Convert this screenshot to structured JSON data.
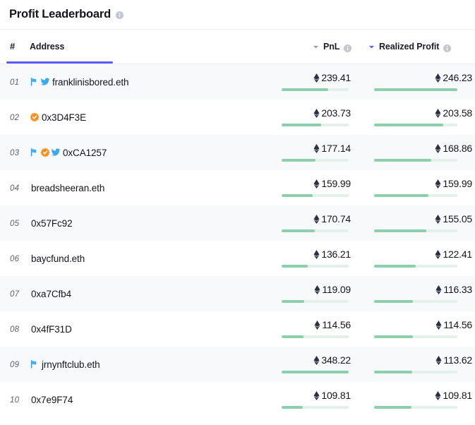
{
  "header": {
    "title": "Profit Leaderboard",
    "title_info_icon": "info-icon"
  },
  "table": {
    "columns": {
      "rank": "#",
      "address": "Address",
      "pnl": "PnL",
      "realized_profit": "Realized Profit"
    },
    "sort": {
      "active_column": "Realized Profit",
      "active_color": "#5b5bf7",
      "inactive_color": "#9aa0ae",
      "direction": "desc"
    },
    "icons": {
      "sort_caret": "chevron-down-icon",
      "info": "info-icon",
      "flag": "flag-icon",
      "opensea": "opensea-verified-icon",
      "twitter": "twitter-icon",
      "currency": "ethereum-icon"
    },
    "colors": {
      "bar_fill": "#8ccfaa",
      "bar_track": "#e4f0ea",
      "row_alt": "#f8f9fb",
      "accent": "#5b5bf7"
    },
    "rows": [
      {
        "rank": "01",
        "address": "franklinisbored.eth",
        "badges": [
          "flag-icon",
          "twitter-icon"
        ],
        "pnl": "239.41",
        "pnl_pct": 69,
        "realized": "246.23",
        "realized_pct": 100
      },
      {
        "rank": "02",
        "address": "0x3D4F3E",
        "badges": [
          "opensea-verified-icon"
        ],
        "pnl": "203.73",
        "pnl_pct": 59,
        "realized": "203.58",
        "realized_pct": 83
      },
      {
        "rank": "03",
        "address": "0xCA1257",
        "badges": [
          "flag-icon",
          "opensea-verified-icon",
          "twitter-icon"
        ],
        "pnl": "177.14",
        "pnl_pct": 51,
        "realized": "168.86",
        "realized_pct": 69
      },
      {
        "rank": "04",
        "address": "breadsheeran.eth",
        "badges": [],
        "pnl": "159.99",
        "pnl_pct": 46,
        "realized": "159.99",
        "realized_pct": 65
      },
      {
        "rank": "05",
        "address": "0x57Fc92",
        "badges": [],
        "pnl": "170.74",
        "pnl_pct": 49,
        "realized": "155.05",
        "realized_pct": 63
      },
      {
        "rank": "06",
        "address": "baycfund.eth",
        "badges": [],
        "pnl": "136.21",
        "pnl_pct": 39,
        "realized": "122.41",
        "realized_pct": 50
      },
      {
        "rank": "07",
        "address": "0xa7Cfb4",
        "badges": [],
        "pnl": "119.09",
        "pnl_pct": 34,
        "realized": "116.33",
        "realized_pct": 47
      },
      {
        "rank": "08",
        "address": "0x4fF31D",
        "badges": [],
        "pnl": "114.56",
        "pnl_pct": 33,
        "realized": "114.56",
        "realized_pct": 47
      },
      {
        "rank": "09",
        "address": "jrnynftclub.eth",
        "badges": [
          "flag-icon"
        ],
        "pnl": "348.22",
        "pnl_pct": 100,
        "realized": "113.62",
        "realized_pct": 46
      },
      {
        "rank": "10",
        "address": "0x7e9F74",
        "badges": [],
        "pnl": "109.81",
        "pnl_pct": 32,
        "realized": "109.81",
        "realized_pct": 45
      }
    ]
  }
}
